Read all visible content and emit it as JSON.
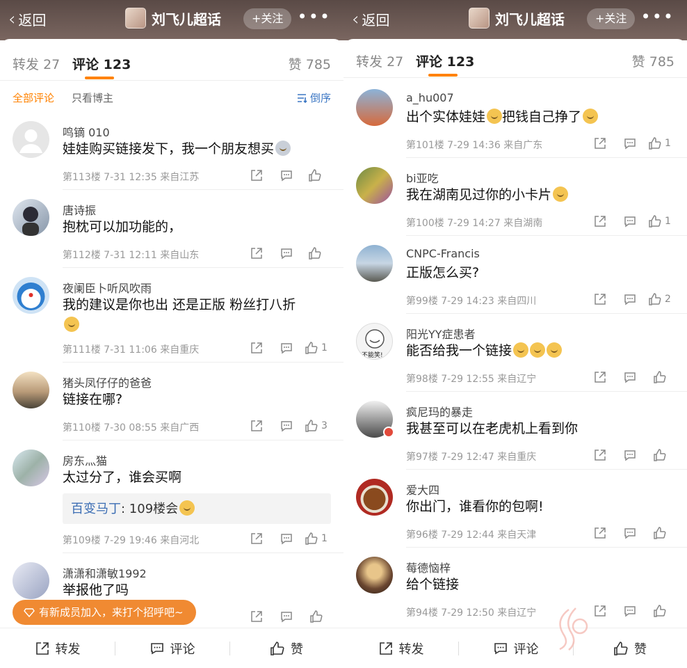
{
  "header": {
    "back_label": "返回",
    "topic_title": "刘飞儿超话",
    "follow_label": "+关注",
    "more_label": "•••"
  },
  "tabs": {
    "repost_label": "转发",
    "repost_count": "27",
    "comment_label": "评论",
    "comment_count": "123",
    "like_label": "赞",
    "like_count": "785"
  },
  "filters": {
    "all": "全部评论",
    "author_only": "只看博主",
    "order": "倒序"
  },
  "left_comments": [
    {
      "user": "鸣镝 010",
      "text": "娃娃购买链接发下，我一个朋友想买",
      "meta": "第113楼  7-31 12:35  来自江苏",
      "likes": ""
    },
    {
      "user": "唐诗振",
      "text": "抱枕可以加功能的，",
      "meta": "第112楼  7-31 12:11  来自山东",
      "likes": ""
    },
    {
      "user": "夜阑臣卜听风吹雨",
      "text": "我的建议是你也出 还是正版 粉丝打八折",
      "meta": "第111楼  7-31 11:06  来自重庆",
      "likes": "1"
    },
    {
      "user": "猪头凤仔仔的爸爸",
      "text": "链接在哪?",
      "meta": "第110楼  7-30 08:55  来自广西",
      "likes": "3"
    },
    {
      "user": "房东灬猫",
      "text": "太过分了，谁会买啊",
      "meta": "第109楼  7-29 19:46  来自河北",
      "likes": "1",
      "quote_name": "百变马丁",
      "quote_text": ": 109楼会"
    },
    {
      "user": "潇潇和潇敏1992",
      "text": "举报他了吗",
      "meta": "",
      "likes": ""
    }
  ],
  "toast_text": "有新成员加入，来打个招呼吧~",
  "right_comments": [
    {
      "user": "a_hu007",
      "text": "出个实体娃娃",
      "text2": "把钱自己挣了",
      "meta": "第101楼  7-29 14:36  来自广东",
      "likes": "1"
    },
    {
      "user": "bi亚吃",
      "text": "我在湖南见过你的小卡片",
      "meta": "第100楼  7-29 14:27  来自湖南",
      "likes": "1"
    },
    {
      "user": "CNPC-Francis",
      "text": "正版怎么买?",
      "meta": "第99楼  7-29 14:23  来自四川",
      "likes": "2"
    },
    {
      "user": "阳光YY症患者",
      "text": "能否给我一个链接",
      "meta": "第98楼  7-29 12:55  来自辽宁",
      "likes": ""
    },
    {
      "user": "疯尼玛的暴走",
      "text": "我甚至可以在老虎机上看到你",
      "meta": "第97楼  7-29 12:47  来自重庆",
      "likes": ""
    },
    {
      "user": "爱大四",
      "text": "你出门，谁看你的包啊!",
      "meta": "第96楼  7-29 12:44  来自天津",
      "likes": ""
    },
    {
      "user": "莓德恼梓",
      "text": "给个链接",
      "meta": "第94楼  7-29 12:50  来自辽宁",
      "likes": ""
    }
  ],
  "avatar_badge_text": "不能笑!",
  "bottom": {
    "repost": "转发",
    "comment": "评论",
    "like": "赞"
  },
  "colors": {
    "accent": "#ff8200",
    "link_blue": "#3c6eb4",
    "header_bg": "#6a5853",
    "toast_bg": "#f08a32"
  }
}
